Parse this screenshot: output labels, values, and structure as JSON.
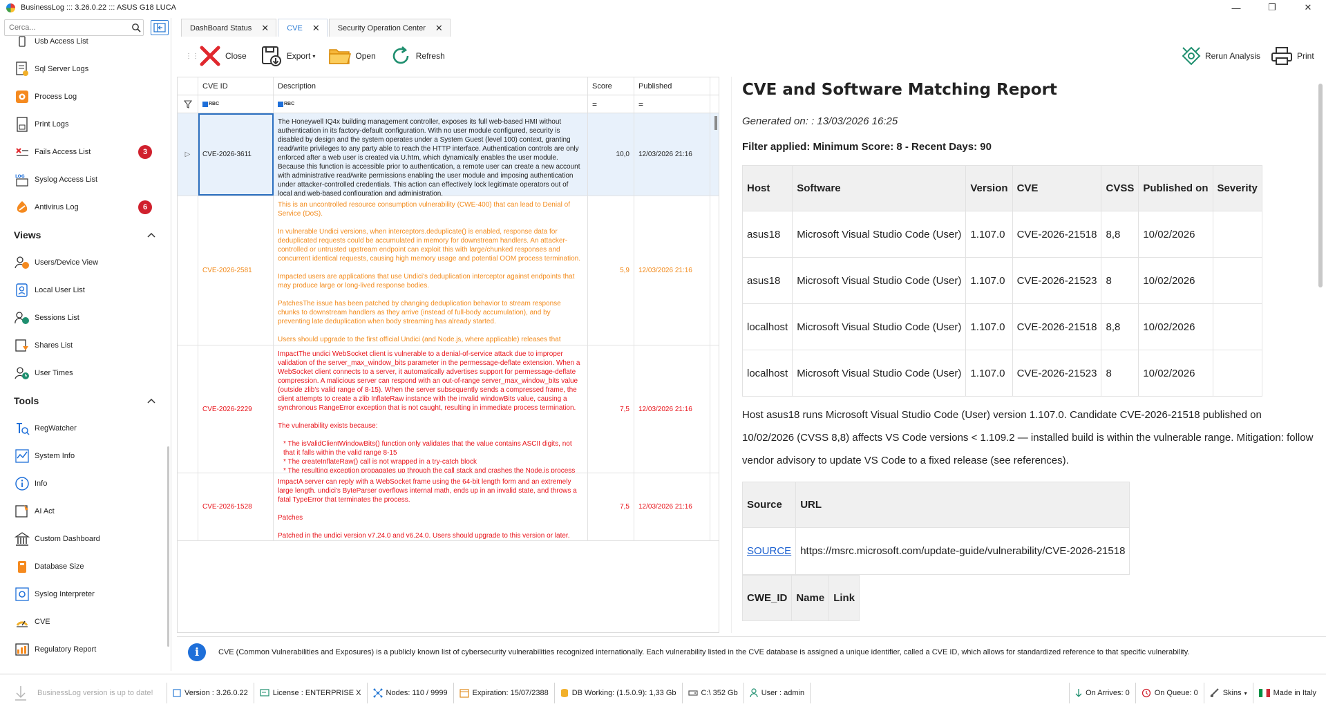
{
  "window": {
    "title": "BusinessLog ::: 3.26.0.22 ::: ASUS G18 LUCA",
    "minimize_glyph": "—",
    "restore_glyph": "❐",
    "close_glyph": "✕"
  },
  "sidebar": {
    "search_placeholder": "Cerca...",
    "items_top": [
      {
        "label": "Usb Access List",
        "icon": "usb-icon"
      },
      {
        "label": "Sql Server Logs",
        "icon": "sql-log-icon"
      },
      {
        "label": "Process Log",
        "icon": "process-icon"
      },
      {
        "label": "Print Logs",
        "icon": "print-log-icon"
      },
      {
        "label": "Fails Access List",
        "icon": "fail-access-icon",
        "badge": "3"
      },
      {
        "label": "Syslog Access List",
        "icon": "syslog-icon"
      },
      {
        "label": "Antivirus Log",
        "icon": "antivirus-icon",
        "badge": "6"
      }
    ],
    "views_title": "Views",
    "views": [
      {
        "label": "Users/Device View",
        "icon": "user-device-icon"
      },
      {
        "label": "Local User List",
        "icon": "local-user-icon"
      },
      {
        "label": "Sessions List",
        "icon": "sessions-icon"
      },
      {
        "label": "Shares List",
        "icon": "shares-icon"
      },
      {
        "label": "User Times",
        "icon": "user-times-icon"
      }
    ],
    "tools_title": "Tools",
    "tools": [
      {
        "label": "RegWatcher",
        "icon": "regwatcher-icon"
      },
      {
        "label": "System Info",
        "icon": "system-info-icon"
      },
      {
        "label": "Info",
        "icon": "info-icon"
      },
      {
        "label": "AI Act",
        "icon": "ai-act-icon"
      },
      {
        "label": "Custom Dashboard",
        "icon": "custom-dashboard-icon"
      },
      {
        "label": "Database Size",
        "icon": "database-size-icon"
      },
      {
        "label": "Syslog Interpreter",
        "icon": "syslog-interpreter-icon"
      },
      {
        "label": "CVE",
        "icon": "cve-icon"
      },
      {
        "label": "Regulatory Report",
        "icon": "regulatory-report-icon"
      }
    ]
  },
  "tabs": [
    {
      "label": "DashBoard Status",
      "active": false
    },
    {
      "label": "CVE",
      "active": true
    },
    {
      "label": "Security Operation Center",
      "active": false
    }
  ],
  "toolbar": {
    "close": "Close",
    "export": "Export",
    "open": "Open",
    "refresh": "Refresh",
    "rerun": "Rerun Analysis",
    "print": "Print"
  },
  "grid": {
    "headers": {
      "id": "CVE ID",
      "desc": "Description",
      "score": "Score",
      "published": "Published"
    },
    "filter_text_glyph": "RBC",
    "filter_eq_glyph": "=",
    "rows": [
      {
        "id": "CVE-2026-3611",
        "score": "10,0",
        "published": "12/03/2026 21:16",
        "color": "black",
        "paragraphs": [
          "The Honeywell IQ4x building management controller, exposes its full web-based HMI without authentication in its factory-default configuration. With no user module configured, security is disabled by design and the system operates under a System Guest (level 100) context, granting read/write privileges to any party able to reach the HTTP interface. Authentication controls are only enforced after a web user is created via U.htm, which dynamically enables the user module. Because this function is accessible prior to authentication, a remote user can create a new account with administrative read/write permissions enabling the user module and imposing authentication under attacker-controlled credentials. This action can effectively lock legitimate operators out of local and web-based configuration and administration."
        ]
      },
      {
        "id": "CVE-2026-2581",
        "score": "5,9",
        "published": "12/03/2026 21:16",
        "color": "orange",
        "paragraphs": [
          "This is an uncontrolled resource consumption vulnerability (CWE-400) that can lead to Denial of Service (DoS).",
          "In vulnerable Undici versions, when interceptors.deduplicate() is enabled, response data for deduplicated requests could be accumulated in memory for downstream handlers. An attacker-controlled or untrusted upstream endpoint can exploit this with large/chunked responses and concurrent identical requests, causing high memory usage and potential OOM process termination.",
          "Impacted users are applications that use Undici's deduplication interceptor against endpoints that may produce large or long-lived response bodies.",
          "PatchesThe issue has been patched by changing deduplication behavior to stream response chunks to downstream handlers as they arrive (instead of full-body accumulation), and by preventing late deduplication when body streaming has already started.",
          "Users should upgrade to the first official Undici (and Node.js, where applicable) releases that include this patch."
        ]
      },
      {
        "id": "CVE-2026-2229",
        "score": "7,5",
        "published": "12/03/2026 21:16",
        "color": "red",
        "paragraphs": [
          "ImpactThe undici WebSocket client is vulnerable to a denial-of-service attack due to improper validation of the server_max_window_bits parameter in the permessage-deflate extension. When a WebSocket client connects to a server, it automatically advertises support for permessage-deflate compression. A malicious server can respond with an out-of-range server_max_window_bits value (outside zlib's valid range of 8-15). When the server subsequently sends a compressed frame, the client attempts to create a zlib InflateRaw instance with the invalid windowBits value, causing a synchronous RangeError exception that is not caught, resulting in immediate process termination.",
          "The vulnerability exists because:"
        ],
        "bullets": [
          "*  The isValidClientWindowBits() function only validates that the value contains ASCII digits, not that it falls within the valid range 8-15",
          "*  The createInflateRaw() call is not wrapped in a try-catch block",
          "*  The resulting exception propagates up through the call stack and crashes the Node.js process"
        ]
      },
      {
        "id": "CVE-2026-1528",
        "score": "7,5",
        "published": "12/03/2026 21:16",
        "color": "red",
        "paragraphs": [
          "ImpactA server can reply with a WebSocket frame using the 64-bit length form and an extremely large length. undici's ByteParser overflows internal math, ends up in an invalid state, and throws a fatal TypeError that terminates the process.",
          "Patches",
          "Patched in the undici version v7.24.0 and v6.24.0. Users should upgrade to this version or later."
        ]
      }
    ]
  },
  "report": {
    "title": "CVE and Software Matching Report",
    "generated": "Generated on: : 13/03/2026 16:25",
    "filter": "Filter applied: Minimum Score: 8 - Recent Days: 90",
    "table_headers": [
      "Host",
      "Software",
      "Version",
      "CVE",
      "CVSS",
      "Published on",
      "Severity"
    ],
    "table_rows": [
      [
        "asus18",
        "Microsoft Visual Studio Code (User)",
        "1.107.0",
        "CVE-2026-21518",
        "8,8",
        "10/02/2026",
        ""
      ],
      [
        "asus18",
        "Microsoft Visual Studio Code (User)",
        "1.107.0",
        "CVE-2026-21523",
        "8",
        "10/02/2026",
        ""
      ],
      [
        "localhost",
        "Microsoft Visual Studio Code (User)",
        "1.107.0",
        "CVE-2026-21518",
        "8,8",
        "10/02/2026",
        ""
      ],
      [
        "localhost",
        "Microsoft Visual Studio Code (User)",
        "1.107.0",
        "CVE-2026-21523",
        "8",
        "10/02/2026",
        ""
      ]
    ],
    "paragraph": "Host asus18 runs Microsoft Visual Studio Code (User) version 1.107.0. Candidate CVE-2026-21518 published on 10/02/2026 (CVSS 8,8) affects VS Code versions < 1.109.2 — installed build is within the vulnerable range. Mitigation: follow vendor advisory to update VS Code to a fixed release (see references).",
    "source_headers": [
      "Source",
      "URL"
    ],
    "source_link": "SOURCE",
    "source_url": "https://msrc.microsoft.com/update-guide/vulnerability/CVE-2026-21518",
    "cwe_headers": [
      "CWE_ID",
      "Name",
      "Link"
    ]
  },
  "info_bar": {
    "text": "CVE (Common Vulnerabilities and Exposures) is a publicly known list of cybersecurity vulnerabilities recognized internationally. Each vulnerability listed in the CVE database is assigned a unique identifier, called a CVE ID, which allows for standardized reference to that specific vulnerability."
  },
  "status": {
    "update": "BusinessLog version is up to date!",
    "version": "Version : 3.26.0.22",
    "license": "License : ENTERPRISE X",
    "nodes": "Nodes: 110 / 9999",
    "expiration": "Expiration: 15/07/2388",
    "db": "DB Working: (1.5.0.9): 1,33 Gb",
    "disk": "C:\\ 352 Gb",
    "user": "User : admin",
    "on_arrives": "On Arrives: 0",
    "on_queue": "On Queue: 0",
    "skins": "Skins",
    "made_in": "Made in Italy"
  },
  "colors": {
    "accent": "#2b7bd4",
    "badge": "#d0202d",
    "orange_text": "#f28a1b",
    "red_text": "#e8131a"
  }
}
